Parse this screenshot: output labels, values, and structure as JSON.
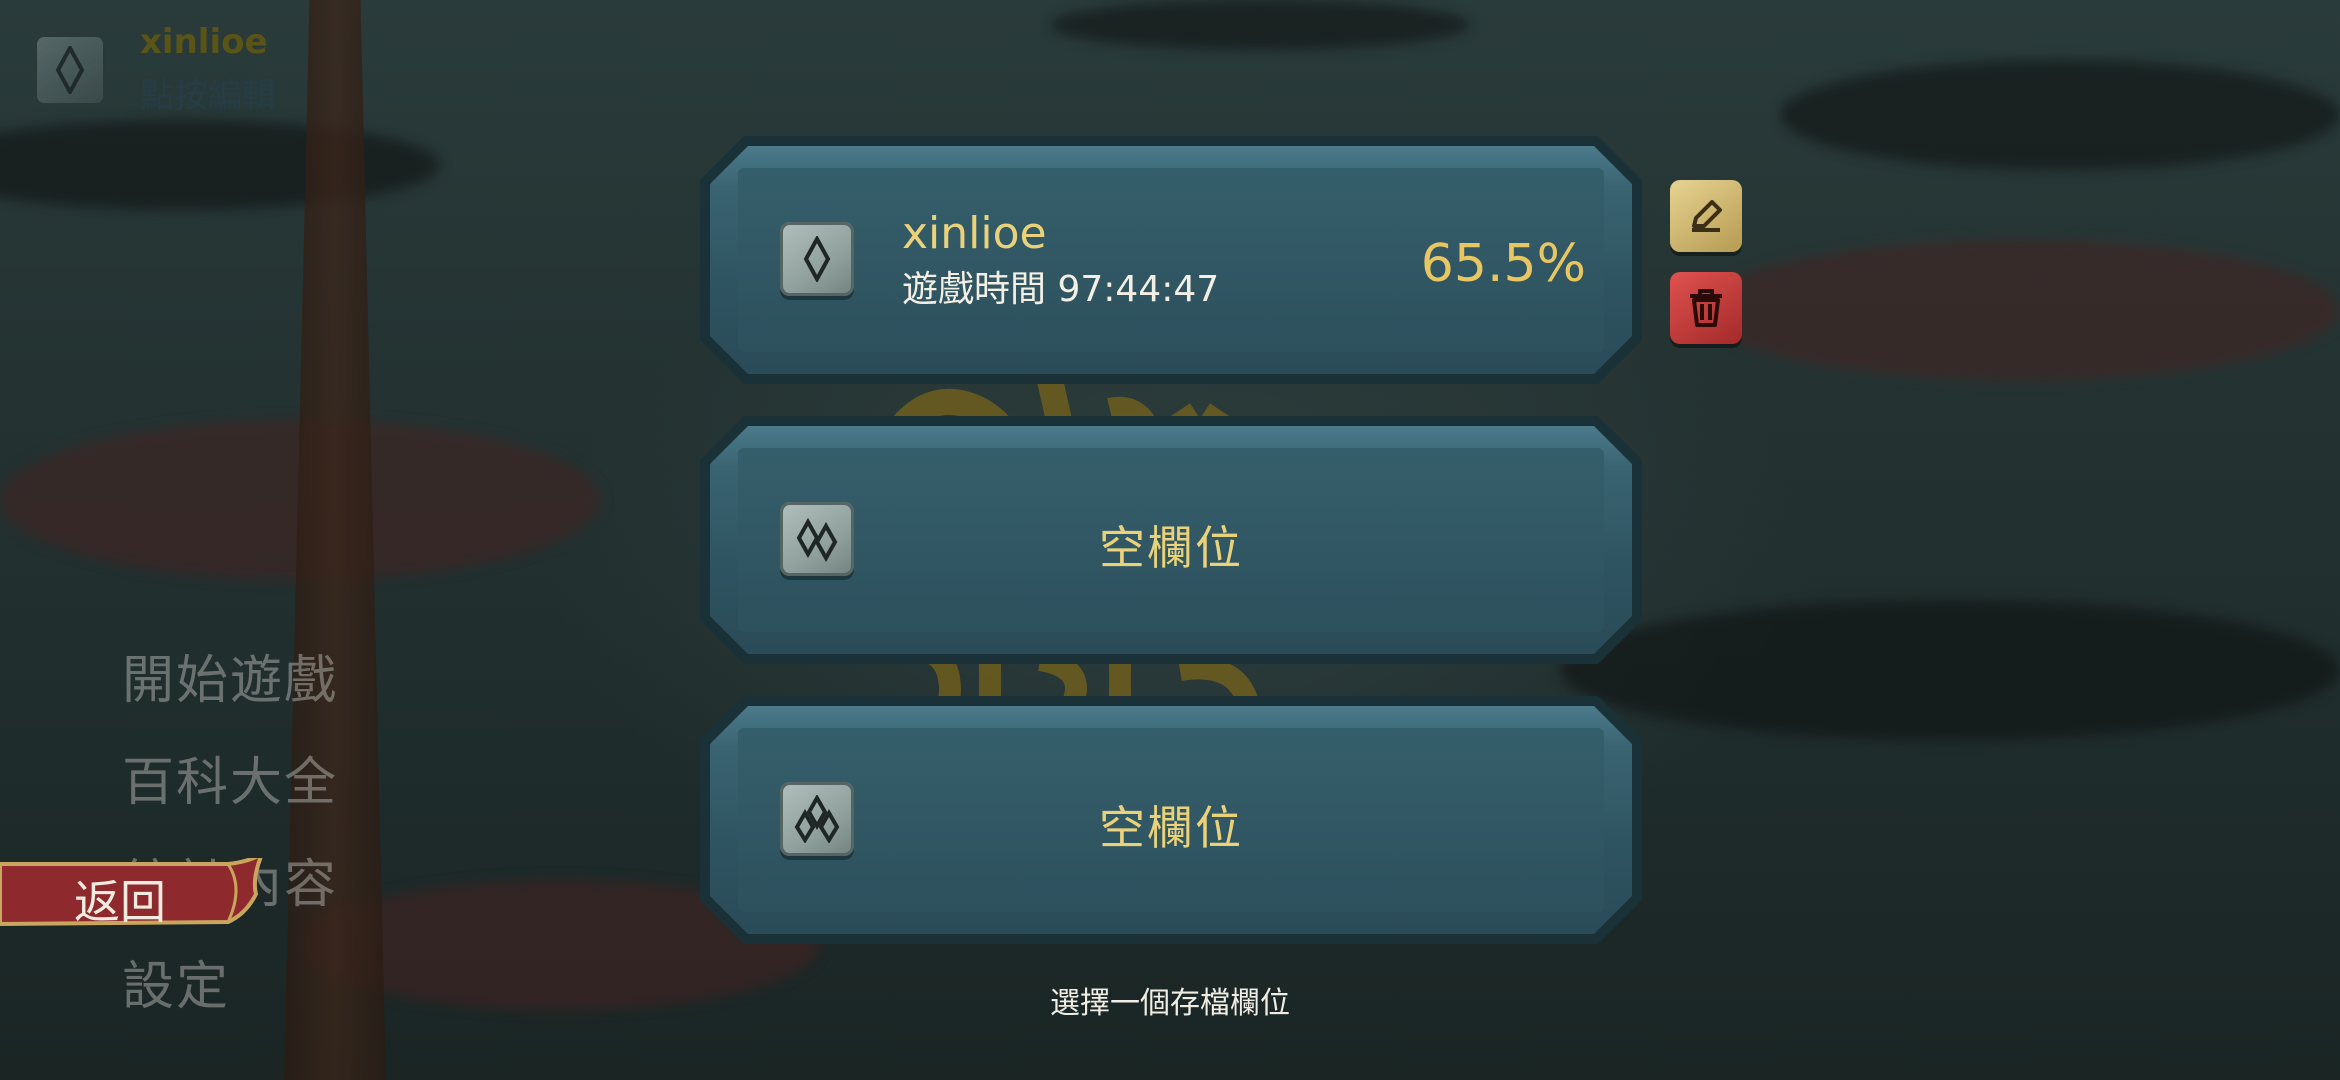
{
  "profile": {
    "name": "xinlioe",
    "edit_hint": "點按編輯"
  },
  "menu": {
    "items": [
      "開始遊戲",
      "百科大全",
      "統計內容",
      "設定"
    ],
    "back_label": "返回"
  },
  "slots": [
    {
      "name": "xinlioe",
      "playtime": "遊戲時間 97:44:47",
      "completion": "65.5%",
      "icon": "single-diamond-icon"
    },
    {
      "empty_label": "空欄位",
      "icon": "double-diamond-icon"
    },
    {
      "empty_label": "空欄位",
      "icon": "triple-diamond-icon"
    }
  ],
  "actions": {
    "edit_icon": "pencil-icon",
    "delete_icon": "trash-icon"
  },
  "hint": "選擇一個存檔欄位",
  "colors": {
    "accent_gold": "#e8c661",
    "slot_blue": "#2f5461",
    "delete_red": "#c03a38",
    "ribbon_red": "#8e2a2e"
  }
}
